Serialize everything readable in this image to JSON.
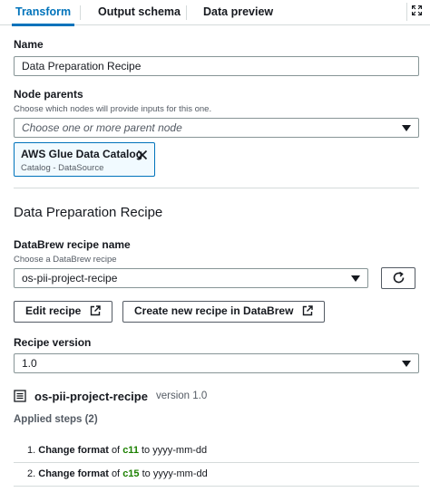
{
  "tabs": [
    {
      "label": "Transform",
      "active": true
    },
    {
      "label": "Output schema",
      "active": false
    },
    {
      "label": "Data preview",
      "active": false
    }
  ],
  "icons": {
    "expand": "expand-icon",
    "close": "close-icon",
    "external": "external-link-icon",
    "refresh": "refresh-icon",
    "recipe": "list-icon",
    "caret": "caret-down-icon"
  },
  "name": {
    "label": "Name",
    "value": "Data Preparation Recipe"
  },
  "node_parents": {
    "label": "Node parents",
    "hint": "Choose which nodes will provide inputs for this one.",
    "placeholder": "Choose one or more parent node",
    "token": {
      "title": "AWS Glue Data Catalog",
      "subtitle": "Catalog - DataSource"
    }
  },
  "section_title": "Data Preparation Recipe",
  "databrew": {
    "label": "DataBrew recipe name",
    "hint": "Choose a DataBrew recipe",
    "selected": "os-pii-project-recipe"
  },
  "buttons": {
    "edit": "Edit recipe",
    "create": "Create new recipe in DataBrew"
  },
  "recipe_version": {
    "label": "Recipe version",
    "selected": "1.0"
  },
  "recipe_summary": {
    "name": "os-pii-project-recipe",
    "version": "version 1.0"
  },
  "applied_steps": {
    "title": "Applied steps (2)",
    "steps": [
      {
        "number": "1.",
        "action": "Change format",
        "of": "of",
        "column": "c11",
        "to": "to",
        "format": "yyyy-mm-dd"
      },
      {
        "number": "2.",
        "action": "Change format",
        "of": "of",
        "column": "c15",
        "to": "to",
        "format": "yyyy-mm-dd"
      }
    ]
  },
  "colors": {
    "accent": "#0073bb",
    "column": "#1d8102",
    "border": "#879596"
  }
}
